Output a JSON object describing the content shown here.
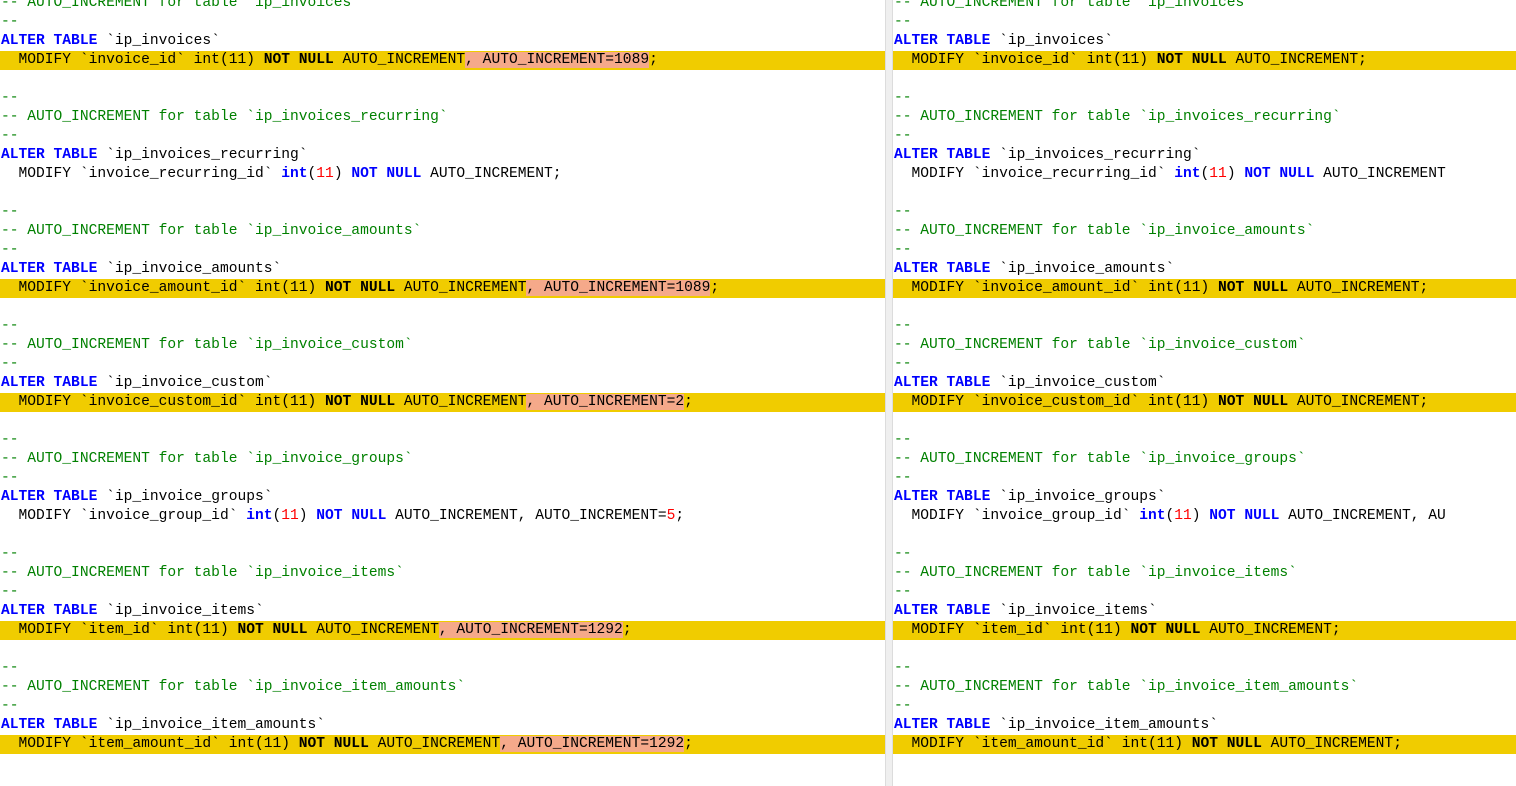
{
  "editor": {
    "type": "sql-diff",
    "colors": {
      "keyword": "#0000ff",
      "comment": "#008000",
      "number": "#ff0000",
      "changed_line": "#f0cc00",
      "removed_text": "#f5a98a"
    },
    "left_pane": {
      "lines": [
        {
          "changed": false,
          "tokens": [
            {
              "t": "cm",
              "v": "-- AUTO_INCREMENT for table `ip_invoices`"
            }
          ]
        },
        {
          "changed": false,
          "tokens": [
            {
              "t": "cm",
              "v": "--"
            }
          ]
        },
        {
          "changed": false,
          "tokens": [
            {
              "t": "kw",
              "v": "ALTER TABLE"
            },
            {
              "t": "pl",
              "v": " `ip_invoices`"
            }
          ]
        },
        {
          "changed": true,
          "tokens": [
            {
              "t": "pl",
              "v": "  MODIFY `invoice_id` int(11) "
            },
            {
              "t": "kw",
              "v": "NOT NULL"
            },
            {
              "t": "pl",
              "v": " AUTO_INCREMENT"
            },
            {
              "t": "del",
              "v": ", AUTO_INCREMENT=1089"
            },
            {
              "t": "pl",
              "v": ";"
            }
          ]
        },
        {
          "changed": false,
          "tokens": []
        },
        {
          "changed": false,
          "tokens": [
            {
              "t": "cm",
              "v": "--"
            }
          ]
        },
        {
          "changed": false,
          "tokens": [
            {
              "t": "cm",
              "v": "-- AUTO_INCREMENT for table `ip_invoices_recurring`"
            }
          ]
        },
        {
          "changed": false,
          "tokens": [
            {
              "t": "cm",
              "v": "--"
            }
          ]
        },
        {
          "changed": false,
          "tokens": [
            {
              "t": "kw",
              "v": "ALTER TABLE"
            },
            {
              "t": "pl",
              "v": " `ip_invoices_recurring`"
            }
          ]
        },
        {
          "changed": false,
          "tokens": [
            {
              "t": "pl",
              "v": "  MODIFY `invoice_recurring_id` "
            },
            {
              "t": "kw",
              "v": "int"
            },
            {
              "t": "pl",
              "v": "("
            },
            {
              "t": "num",
              "v": "11"
            },
            {
              "t": "pl",
              "v": ") "
            },
            {
              "t": "kw",
              "v": "NOT NULL"
            },
            {
              "t": "pl",
              "v": " AUTO_INCREMENT;"
            }
          ]
        },
        {
          "changed": false,
          "tokens": []
        },
        {
          "changed": false,
          "tokens": [
            {
              "t": "cm",
              "v": "--"
            }
          ]
        },
        {
          "changed": false,
          "tokens": [
            {
              "t": "cm",
              "v": "-- AUTO_INCREMENT for table `ip_invoice_amounts`"
            }
          ]
        },
        {
          "changed": false,
          "tokens": [
            {
              "t": "cm",
              "v": "--"
            }
          ]
        },
        {
          "changed": false,
          "tokens": [
            {
              "t": "kw",
              "v": "ALTER TABLE"
            },
            {
              "t": "pl",
              "v": " `ip_invoice_amounts`"
            }
          ]
        },
        {
          "changed": true,
          "tokens": [
            {
              "t": "pl",
              "v": "  MODIFY `invoice_amount_id` int(11) "
            },
            {
              "t": "kw",
              "v": "NOT NULL"
            },
            {
              "t": "pl",
              "v": " AUTO_INCREMENT"
            },
            {
              "t": "del",
              "v": ", AUTO_INCREMENT=1089"
            },
            {
              "t": "pl",
              "v": ";"
            }
          ]
        },
        {
          "changed": false,
          "tokens": []
        },
        {
          "changed": false,
          "tokens": [
            {
              "t": "cm",
              "v": "--"
            }
          ]
        },
        {
          "changed": false,
          "tokens": [
            {
              "t": "cm",
              "v": "-- AUTO_INCREMENT for table `ip_invoice_custom`"
            }
          ]
        },
        {
          "changed": false,
          "tokens": [
            {
              "t": "cm",
              "v": "--"
            }
          ]
        },
        {
          "changed": false,
          "tokens": [
            {
              "t": "kw",
              "v": "ALTER TABLE"
            },
            {
              "t": "pl",
              "v": " `ip_invoice_custom`"
            }
          ]
        },
        {
          "changed": true,
          "tokens": [
            {
              "t": "pl",
              "v": "  MODIFY `invoice_custom_id` int(11) "
            },
            {
              "t": "kw",
              "v": "NOT NULL"
            },
            {
              "t": "pl",
              "v": " AUTO_INCREMENT"
            },
            {
              "t": "del",
              "v": ", AUTO_INCREMENT=2"
            },
            {
              "t": "pl",
              "v": ";"
            }
          ]
        },
        {
          "changed": false,
          "tokens": []
        },
        {
          "changed": false,
          "tokens": [
            {
              "t": "cm",
              "v": "--"
            }
          ]
        },
        {
          "changed": false,
          "tokens": [
            {
              "t": "cm",
              "v": "-- AUTO_INCREMENT for table `ip_invoice_groups`"
            }
          ]
        },
        {
          "changed": false,
          "tokens": [
            {
              "t": "cm",
              "v": "--"
            }
          ]
        },
        {
          "changed": false,
          "tokens": [
            {
              "t": "kw",
              "v": "ALTER TABLE"
            },
            {
              "t": "pl",
              "v": " `ip_invoice_groups`"
            }
          ]
        },
        {
          "changed": false,
          "tokens": [
            {
              "t": "pl",
              "v": "  MODIFY `invoice_group_id` "
            },
            {
              "t": "kw",
              "v": "int"
            },
            {
              "t": "pl",
              "v": "("
            },
            {
              "t": "num",
              "v": "11"
            },
            {
              "t": "pl",
              "v": ") "
            },
            {
              "t": "kw",
              "v": "NOT NULL"
            },
            {
              "t": "pl",
              "v": " AUTO_INCREMENT, AUTO_INCREMENT="
            },
            {
              "t": "num",
              "v": "5"
            },
            {
              "t": "pl",
              "v": ";"
            }
          ]
        },
        {
          "changed": false,
          "tokens": []
        },
        {
          "changed": false,
          "tokens": [
            {
              "t": "cm",
              "v": "--"
            }
          ]
        },
        {
          "changed": false,
          "tokens": [
            {
              "t": "cm",
              "v": "-- AUTO_INCREMENT for table `ip_invoice_items`"
            }
          ]
        },
        {
          "changed": false,
          "tokens": [
            {
              "t": "cm",
              "v": "--"
            }
          ]
        },
        {
          "changed": false,
          "tokens": [
            {
              "t": "kw",
              "v": "ALTER TABLE"
            },
            {
              "t": "pl",
              "v": " `ip_invoice_items`"
            }
          ]
        },
        {
          "changed": true,
          "tokens": [
            {
              "t": "pl",
              "v": "  MODIFY `item_id` int(11) "
            },
            {
              "t": "kw",
              "v": "NOT NULL"
            },
            {
              "t": "pl",
              "v": " AUTO_INCREMENT"
            },
            {
              "t": "del",
              "v": ", AUTO_INCREMENT=1292"
            },
            {
              "t": "pl",
              "v": ";"
            }
          ]
        },
        {
          "changed": false,
          "tokens": []
        },
        {
          "changed": false,
          "tokens": [
            {
              "t": "cm",
              "v": "--"
            }
          ]
        },
        {
          "changed": false,
          "tokens": [
            {
              "t": "cm",
              "v": "-- AUTO_INCREMENT for table `ip_invoice_item_amounts`"
            }
          ]
        },
        {
          "changed": false,
          "tokens": [
            {
              "t": "cm",
              "v": "--"
            }
          ]
        },
        {
          "changed": false,
          "tokens": [
            {
              "t": "kw",
              "v": "ALTER TABLE"
            },
            {
              "t": "pl",
              "v": " `ip_invoice_item_amounts`"
            }
          ]
        },
        {
          "changed": true,
          "tokens": [
            {
              "t": "pl",
              "v": "  MODIFY `item_amount_id` int(11) "
            },
            {
              "t": "kw",
              "v": "NOT NULL"
            },
            {
              "t": "pl",
              "v": " AUTO_INCREMENT"
            },
            {
              "t": "del",
              "v": ", AUTO_INCREMENT=1292"
            },
            {
              "t": "pl",
              "v": ";"
            }
          ]
        }
      ]
    },
    "right_pane": {
      "lines": [
        {
          "changed": false,
          "tokens": [
            {
              "t": "cm",
              "v": "-- AUTO_INCREMENT for table `ip_invoices`"
            }
          ]
        },
        {
          "changed": false,
          "tokens": [
            {
              "t": "cm",
              "v": "--"
            }
          ]
        },
        {
          "changed": false,
          "tokens": [
            {
              "t": "kw",
              "v": "ALTER TABLE"
            },
            {
              "t": "pl",
              "v": " `ip_invoices`"
            }
          ]
        },
        {
          "changed": true,
          "tokens": [
            {
              "t": "pl",
              "v": "  MODIFY `invoice_id` int(11) "
            },
            {
              "t": "kw",
              "v": "NOT NULL"
            },
            {
              "t": "pl",
              "v": " AUTO_INCREMENT;"
            }
          ]
        },
        {
          "changed": false,
          "tokens": []
        },
        {
          "changed": false,
          "tokens": [
            {
              "t": "cm",
              "v": "--"
            }
          ]
        },
        {
          "changed": false,
          "tokens": [
            {
              "t": "cm",
              "v": "-- AUTO_INCREMENT for table `ip_invoices_recurring`"
            }
          ]
        },
        {
          "changed": false,
          "tokens": [
            {
              "t": "cm",
              "v": "--"
            }
          ]
        },
        {
          "changed": false,
          "tokens": [
            {
              "t": "kw",
              "v": "ALTER TABLE"
            },
            {
              "t": "pl",
              "v": " `ip_invoices_recurring`"
            }
          ]
        },
        {
          "changed": false,
          "tokens": [
            {
              "t": "pl",
              "v": "  MODIFY `invoice_recurring_id` "
            },
            {
              "t": "kw",
              "v": "int"
            },
            {
              "t": "pl",
              "v": "("
            },
            {
              "t": "num",
              "v": "11"
            },
            {
              "t": "pl",
              "v": ") "
            },
            {
              "t": "kw",
              "v": "NOT NULL"
            },
            {
              "t": "pl",
              "v": " AUTO_INCREMENT"
            }
          ]
        },
        {
          "changed": false,
          "tokens": []
        },
        {
          "changed": false,
          "tokens": [
            {
              "t": "cm",
              "v": "--"
            }
          ]
        },
        {
          "changed": false,
          "tokens": [
            {
              "t": "cm",
              "v": "-- AUTO_INCREMENT for table `ip_invoice_amounts`"
            }
          ]
        },
        {
          "changed": false,
          "tokens": [
            {
              "t": "cm",
              "v": "--"
            }
          ]
        },
        {
          "changed": false,
          "tokens": [
            {
              "t": "kw",
              "v": "ALTER TABLE"
            },
            {
              "t": "pl",
              "v": " `ip_invoice_amounts`"
            }
          ]
        },
        {
          "changed": true,
          "tokens": [
            {
              "t": "pl",
              "v": "  MODIFY `invoice_amount_id` int(11) "
            },
            {
              "t": "kw",
              "v": "NOT NULL"
            },
            {
              "t": "pl",
              "v": " AUTO_INCREMENT;"
            }
          ]
        },
        {
          "changed": false,
          "tokens": []
        },
        {
          "changed": false,
          "tokens": [
            {
              "t": "cm",
              "v": "--"
            }
          ]
        },
        {
          "changed": false,
          "tokens": [
            {
              "t": "cm",
              "v": "-- AUTO_INCREMENT for table `ip_invoice_custom`"
            }
          ]
        },
        {
          "changed": false,
          "tokens": [
            {
              "t": "cm",
              "v": "--"
            }
          ]
        },
        {
          "changed": false,
          "tokens": [
            {
              "t": "kw",
              "v": "ALTER TABLE"
            },
            {
              "t": "pl",
              "v": " `ip_invoice_custom`"
            }
          ]
        },
        {
          "changed": true,
          "tokens": [
            {
              "t": "pl",
              "v": "  MODIFY `invoice_custom_id` int(11) "
            },
            {
              "t": "kw",
              "v": "NOT NULL"
            },
            {
              "t": "pl",
              "v": " AUTO_INCREMENT;"
            }
          ]
        },
        {
          "changed": false,
          "tokens": []
        },
        {
          "changed": false,
          "tokens": [
            {
              "t": "cm",
              "v": "--"
            }
          ]
        },
        {
          "changed": false,
          "tokens": [
            {
              "t": "cm",
              "v": "-- AUTO_INCREMENT for table `ip_invoice_groups`"
            }
          ]
        },
        {
          "changed": false,
          "tokens": [
            {
              "t": "cm",
              "v": "--"
            }
          ]
        },
        {
          "changed": false,
          "tokens": [
            {
              "t": "kw",
              "v": "ALTER TABLE"
            },
            {
              "t": "pl",
              "v": " `ip_invoice_groups`"
            }
          ]
        },
        {
          "changed": false,
          "tokens": [
            {
              "t": "pl",
              "v": "  MODIFY `invoice_group_id` "
            },
            {
              "t": "kw",
              "v": "int"
            },
            {
              "t": "pl",
              "v": "("
            },
            {
              "t": "num",
              "v": "11"
            },
            {
              "t": "pl",
              "v": ") "
            },
            {
              "t": "kw",
              "v": "NOT NULL"
            },
            {
              "t": "pl",
              "v": " AUTO_INCREMENT, AU"
            }
          ]
        },
        {
          "changed": false,
          "tokens": []
        },
        {
          "changed": false,
          "tokens": [
            {
              "t": "cm",
              "v": "--"
            }
          ]
        },
        {
          "changed": false,
          "tokens": [
            {
              "t": "cm",
              "v": "-- AUTO_INCREMENT for table `ip_invoice_items`"
            }
          ]
        },
        {
          "changed": false,
          "tokens": [
            {
              "t": "cm",
              "v": "--"
            }
          ]
        },
        {
          "changed": false,
          "tokens": [
            {
              "t": "kw",
              "v": "ALTER TABLE"
            },
            {
              "t": "pl",
              "v": " `ip_invoice_items`"
            }
          ]
        },
        {
          "changed": true,
          "tokens": [
            {
              "t": "pl",
              "v": "  MODIFY `item_id` int(11) "
            },
            {
              "t": "kw",
              "v": "NOT NULL"
            },
            {
              "t": "pl",
              "v": " AUTO_INCREMENT;"
            }
          ]
        },
        {
          "changed": false,
          "tokens": []
        },
        {
          "changed": false,
          "tokens": [
            {
              "t": "cm",
              "v": "--"
            }
          ]
        },
        {
          "changed": false,
          "tokens": [
            {
              "t": "cm",
              "v": "-- AUTO_INCREMENT for table `ip_invoice_item_amounts`"
            }
          ]
        },
        {
          "changed": false,
          "tokens": [
            {
              "t": "cm",
              "v": "--"
            }
          ]
        },
        {
          "changed": false,
          "tokens": [
            {
              "t": "kw",
              "v": "ALTER TABLE"
            },
            {
              "t": "pl",
              "v": " `ip_invoice_item_amounts`"
            }
          ]
        },
        {
          "changed": true,
          "tokens": [
            {
              "t": "pl",
              "v": "  MODIFY `item_amount_id` int(11) "
            },
            {
              "t": "kw",
              "v": "NOT NULL"
            },
            {
              "t": "pl",
              "v": " AUTO_INCREMENT;"
            }
          ]
        }
      ]
    }
  }
}
